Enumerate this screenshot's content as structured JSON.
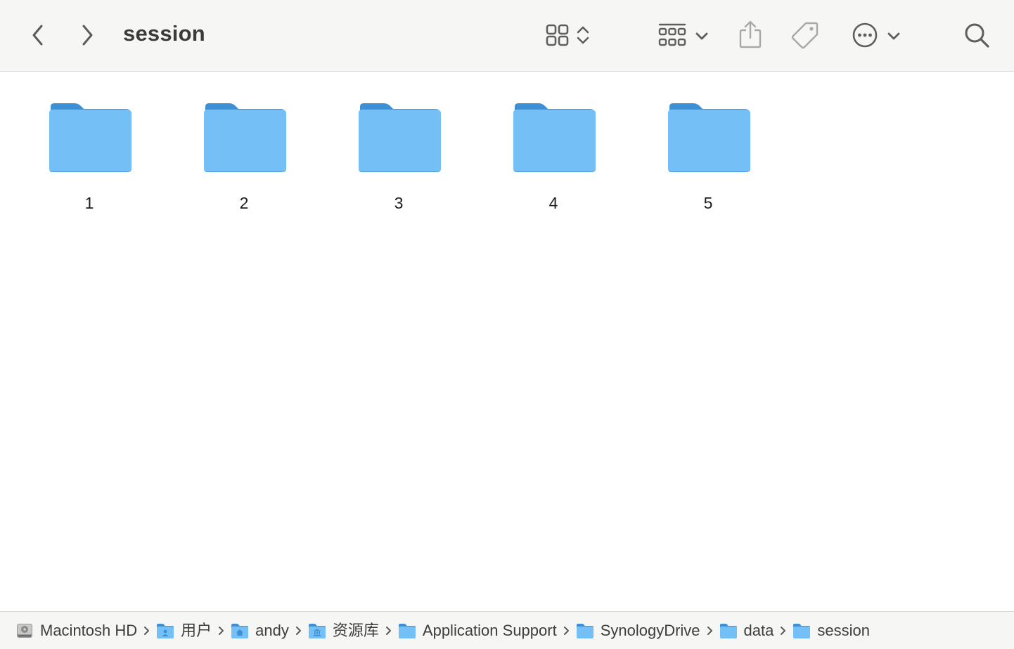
{
  "window": {
    "title": "session"
  },
  "toolbar": {
    "back_icon": "chevron-left-icon",
    "forward_icon": "chevron-right-icon",
    "view_icon": "icon-view-grid-icon",
    "group_icon": "group-by-icon",
    "share_icon": "share-icon",
    "tag_icon": "tag-icon",
    "more_icon": "ellipsis-circle-icon",
    "search_icon": "search-icon"
  },
  "folders": [
    {
      "name": "1"
    },
    {
      "name": "2"
    },
    {
      "name": "3"
    },
    {
      "name": "4"
    },
    {
      "name": "5"
    }
  ],
  "path_bar": [
    {
      "label": "Macintosh HD",
      "icon": "hard-drive-icon"
    },
    {
      "label": "用户",
      "icon": "users-folder-icon"
    },
    {
      "label": "andy",
      "icon": "home-folder-icon"
    },
    {
      "label": "资源库",
      "icon": "library-folder-icon"
    },
    {
      "label": "Application Support",
      "icon": "folder-icon"
    },
    {
      "label": "SynologyDrive",
      "icon": "folder-icon"
    },
    {
      "label": "data",
      "icon": "folder-icon"
    },
    {
      "label": "session",
      "icon": "folder-icon"
    }
  ],
  "colors": {
    "folder_front": "#74c0f6",
    "folder_back": "#3d8fd6",
    "toolbar_bg": "#f6f7f5",
    "icon_gray": "#6e6e6e"
  }
}
